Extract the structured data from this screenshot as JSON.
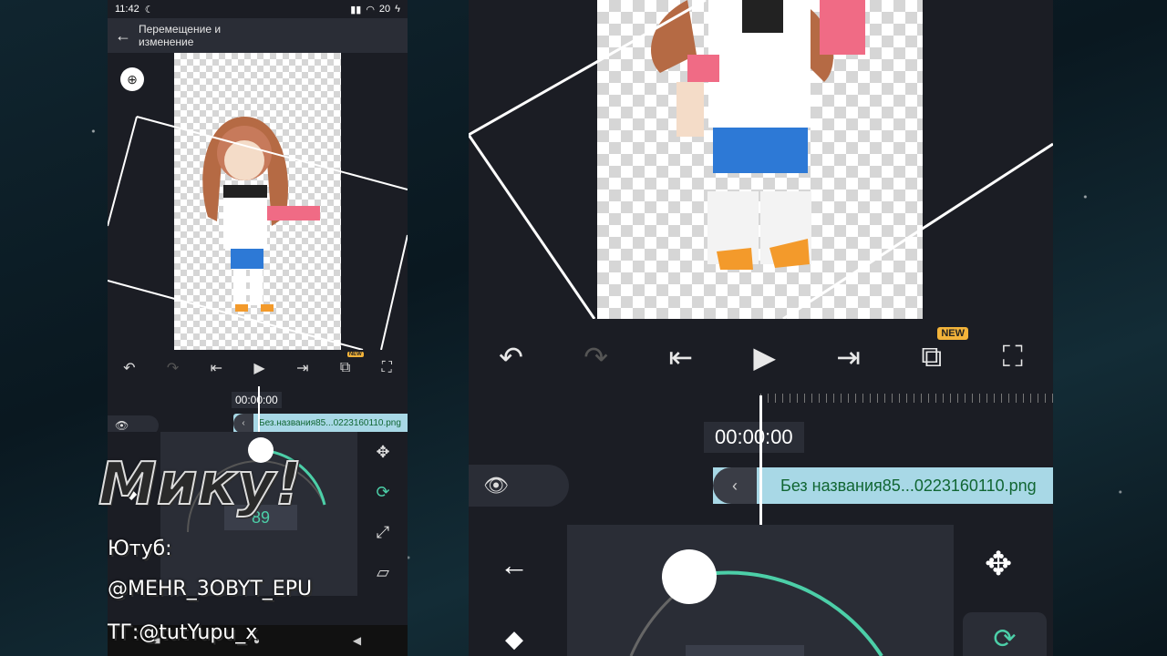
{
  "status": {
    "time": "11:42",
    "battery": "20"
  },
  "appbar": {
    "title_line1": "Перемещение и",
    "title_line2": "изменение"
  },
  "timeline": {
    "timecode": "00:00:00",
    "clip_name": "Без.названия85...0223160110.png",
    "clip_name_big": "Без названия85...0223160110.png"
  },
  "toolbar": {
    "new_badge": "NEW"
  },
  "rotation": {
    "angle": "89"
  },
  "watermark": {
    "logo": "Мику!",
    "line1": "Ютуб:",
    "line2": "@MEHR_3OBYT_EPU",
    "line3": "TГ:@tutYupu_x"
  },
  "icons": [
    "back-arrow-icon",
    "zoom-icon",
    "undo-icon",
    "redo-icon",
    "skip-start-icon",
    "play-icon",
    "skip-end-icon",
    "overlay-new-icon",
    "fit-screen-icon",
    "eye-icon",
    "move-icon",
    "rotate-icon",
    "scale-icon",
    "skew-icon",
    "keyframe-icon"
  ]
}
